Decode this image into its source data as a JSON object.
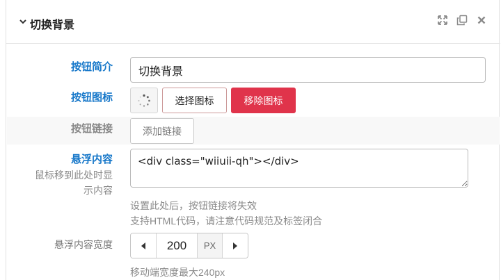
{
  "panel": {
    "title": "切换背景",
    "icons": [
      "expand-icon",
      "copy-icon",
      "close-icon"
    ]
  },
  "fields": {
    "brief": {
      "label": "按钮简介",
      "value": "切换背景"
    },
    "icon": {
      "label": "按钮图标",
      "preview_icon": "spinner-icon",
      "choose_label": "选择图标",
      "remove_label": "移除图标"
    },
    "link": {
      "label": "按钮链接",
      "add_label": "添加链接"
    },
    "hover": {
      "label": "悬浮内容",
      "sublabel_line1": "鼠标移到此处时显",
      "sublabel_line2": "示内容",
      "value": "<div class=\"wiiuii-qh\"></div>",
      "help_line1": "设置此处后，按钮链接将失效",
      "help_line2": "支持HTML代码，请注意代码规范及标签闭合"
    },
    "width": {
      "label": "悬浮内容宽度",
      "value": "200",
      "unit": "PX",
      "help": "移动端宽度最大240px"
    }
  },
  "colors": {
    "accent": "#1677c9",
    "danger": "#e0344b"
  }
}
